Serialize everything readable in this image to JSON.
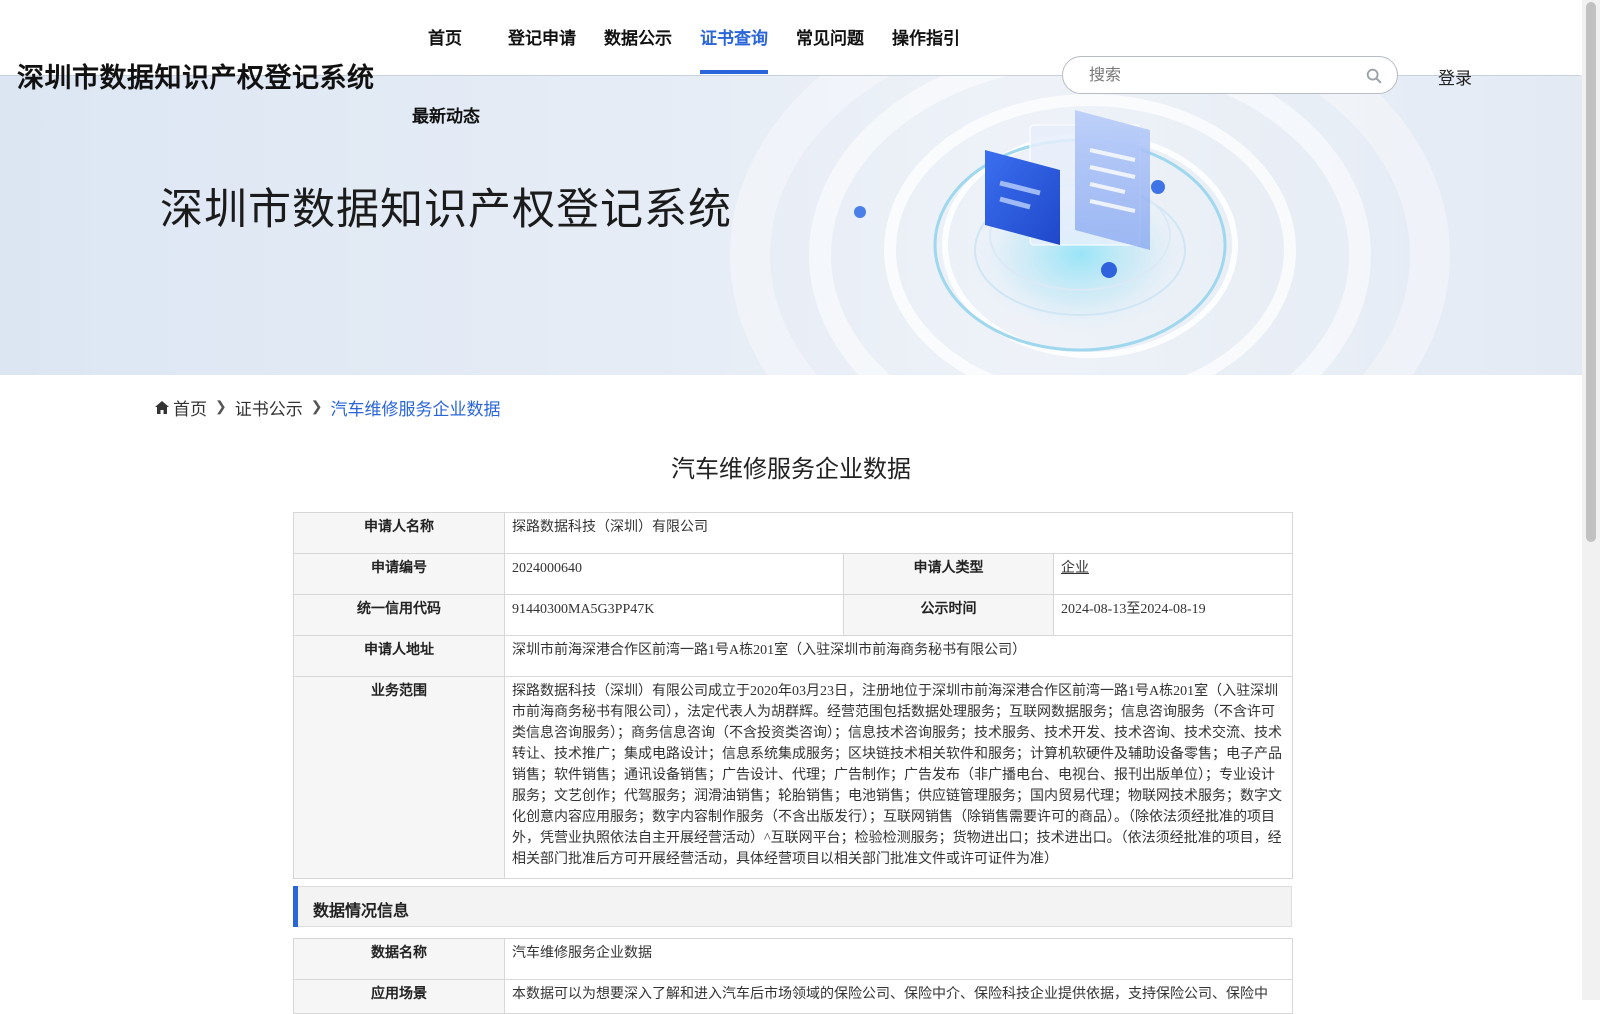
{
  "header": {
    "site_title": "深圳市数据知识产权登记系统",
    "nav": [
      {
        "label": "首页",
        "active": false
      },
      {
        "label": "登记申请",
        "active": false
      },
      {
        "label": "数据公示",
        "active": false
      },
      {
        "label": "证书查询",
        "active": true
      },
      {
        "label": "常见问题",
        "active": false
      },
      {
        "label": "操作指引",
        "active": false
      }
    ],
    "nav_second_row": "最新动态",
    "search": {
      "placeholder": "搜索",
      "value": ""
    },
    "login_label": "登录"
  },
  "banner": {
    "title": "深圳市数据知识产权登记系统"
  },
  "breadcrumb": {
    "home": "首页",
    "items": [
      "证书公示",
      "汽车维修服务企业数据"
    ]
  },
  "page_title": "汽车维修服务企业数据",
  "applicant": {
    "name_label": "申请人名称",
    "name_value": "探路数据科技（深圳）有限公司",
    "app_no_label": "申请编号",
    "app_no_value": "2024000640",
    "type_label": "申请人类型",
    "type_value": "企业",
    "credit_label": "统一信用代码",
    "credit_value": "91440300MA5G3PP47K",
    "publicity_label": "公示时间",
    "publicity_value": "2024-08-13至2024-08-19",
    "address_label": "申请人地址",
    "address_value": "深圳市前海深港合作区前湾一路1号A栋201室（入驻深圳市前海商务秘书有限公司）",
    "scope_label": "业务范围",
    "scope_value": "探路数据科技（深圳）有限公司成立于2020年03月23日，注册地位于深圳市前海深港合作区前湾一路1号A栋201室（入驻深圳市前海商务秘书有限公司），法定代表人为胡群辉。经营范围包括数据处理服务；互联网数据服务；信息咨询服务（不含许可类信息咨询服务）；商务信息咨询（不含投资类咨询）；信息技术咨询服务；技术服务、技术开发、技术咨询、技术交流、技术转让、技术推广；集成电路设计；信息系统集成服务；区块链技术相关软件和服务；计算机软硬件及辅助设备零售；电子产品销售；软件销售；通讯设备销售；广告设计、代理；广告制作；广告发布（非广播电台、电视台、报刊出版单位）；专业设计服务；文艺创作；代驾服务；润滑油销售；轮胎销售；电池销售；供应链管理服务；国内贸易代理；物联网技术服务；数字文化创意内容应用服务；数字内容制作服务（不含出版发行）；互联网销售（除销售需要许可的商品）。（除依法须经批准的项目外，凭营业执照依法自主开展经营活动）^互联网平台；检验检测服务；货物进出口；技术进出口。（依法须经批准的项目，经相关部门批准后方可开展经营活动，具体经营项目以相关部门批准文件或许可证件为准）"
  },
  "data_section": {
    "heading": "数据情况信息",
    "data_name_label": "数据名称",
    "data_name_value": "汽车维修服务企业数据",
    "scenario_label": "应用场景",
    "scenario_value": "本数据可以为想要深入了解和进入汽车后市场领域的保险公司、保险中介、保险科技企业提供依据，支持保险公司、保险中"
  },
  "colors": {
    "accent": "#2a66d9"
  }
}
